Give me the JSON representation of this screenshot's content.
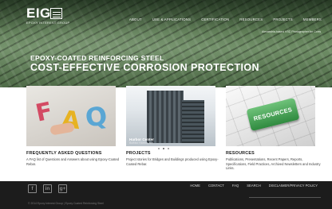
{
  "logo": {
    "text": "EIG",
    "tagline": "EPOXY INTEREST GROUP"
  },
  "nav": {
    "items": [
      "ABOUT",
      "USE & APPLICATIONS",
      "CERTIFICATION",
      "RESOURCES",
      "PROJECTS",
      "MEMBERS"
    ]
  },
  "hero": {
    "photo_credit": "Alexandria-based VSC Photographer for Corrs",
    "subtitle": "EPOXY-COATED REINFORCING STEEL",
    "title": "COST-EFFECTIVE CORROSION PROTECTION"
  },
  "cards": [
    {
      "title": "FREQUENTLY ASKED QUESTIONS",
      "desc": "A FAQ list of Questions and Answers about using Epoxy-Coated Rebar.",
      "image_letters": [
        "F",
        "A",
        "Q"
      ]
    },
    {
      "title": "PROJECTS",
      "desc": "Project stories for Bridges and Buildings produced using Epoxy-Coated Rebar.",
      "caption_title": "Harbor Center",
      "caption_sub": "Buffalo Harbor, NY"
    },
    {
      "title": "RESOURCES",
      "desc": "Publications, Presentations, Recent Papers, Reports, Specifications, Field Practices, Archived Newsletters and Industry Links.",
      "key_label": "RESOURCES"
    }
  ],
  "carousel": {
    "active_index": 1,
    "count": 3
  },
  "footer": {
    "social": [
      "f",
      "in",
      "g+"
    ],
    "links": [
      "HOME",
      "CONTACT",
      "FAQ",
      "SEARCH",
      "DISCLAIMER/PRIVACY POLICY"
    ],
    "copyright": "© 2014 Epoxy Interest Group | Epoxy Coated Reinforcing Steel"
  }
}
